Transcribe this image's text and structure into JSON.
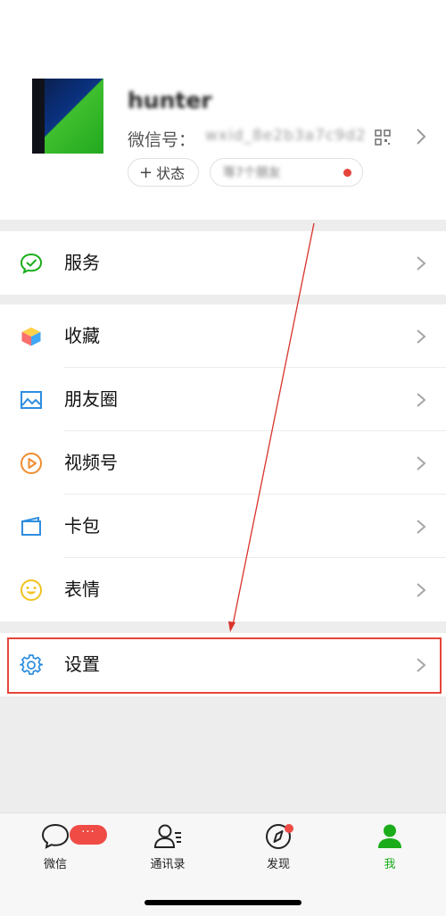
{
  "profile": {
    "name": "hunter",
    "wechat_id_label": "微信号：",
    "wechat_id_value": "wxid_8e2b3a7c9d2",
    "status_plus": "+",
    "status_label": "状态",
    "friends_text": "等7个朋友"
  },
  "menu": {
    "service": "服务",
    "favorites": "收藏",
    "moments": "朋友圈",
    "channels": "视频号",
    "cards": "卡包",
    "stickers": "表情",
    "settings": "设置"
  },
  "tabbar": {
    "chats": "微信",
    "contacts": "通讯录",
    "discover": "发现",
    "me": "我",
    "chats_badge": "···"
  },
  "colors": {
    "accent_green": "#1aad19",
    "alert_red": "#e5453a"
  }
}
